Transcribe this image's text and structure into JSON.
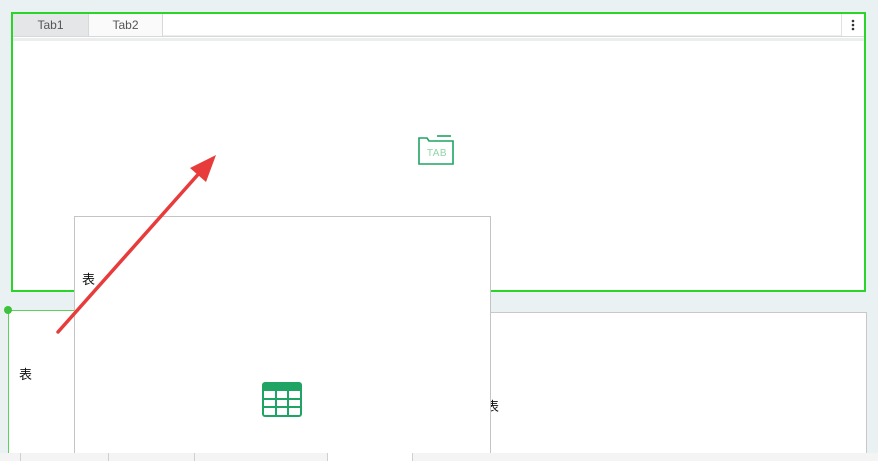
{
  "tabs": [
    {
      "label": "Tab1",
      "active": true
    },
    {
      "label": "Tab2",
      "active": false
    }
  ],
  "tab_menu_icon": "more-vertical-icon",
  "tab_placeholder": {
    "icon": "folder-tab-icon",
    "text": "TAB"
  },
  "card_label": "表",
  "left_frame_label": "表",
  "right_frame_label": "表",
  "table_icon": "table-icon",
  "colors": {
    "selection_green": "#2bd42b",
    "icon_green": "#1fa463",
    "arrow_red": "#e83b3b",
    "background": "#e9f1f3"
  }
}
